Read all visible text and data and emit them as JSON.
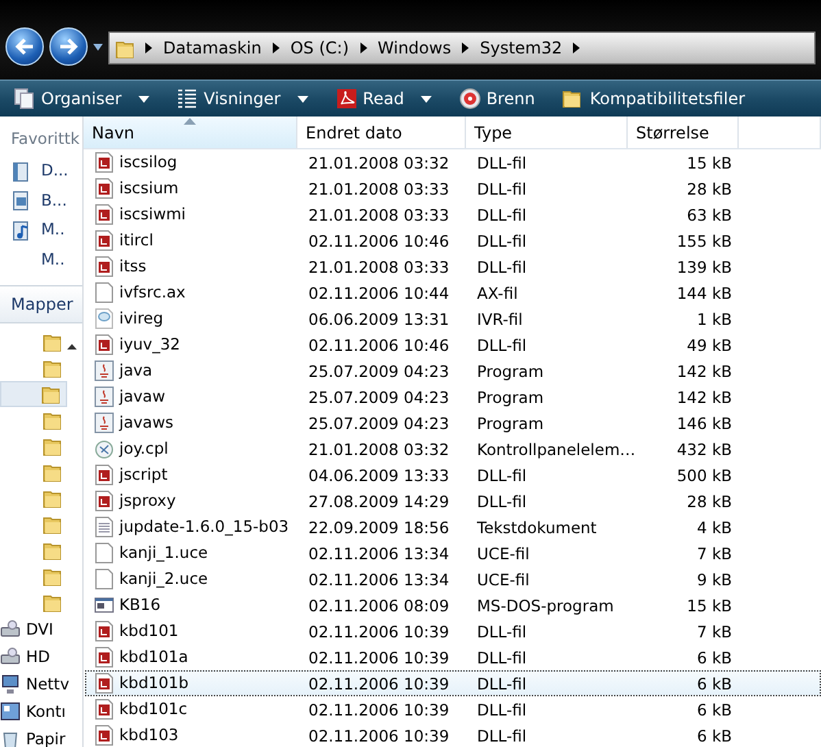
{
  "address_bar": {
    "crumbs": [
      "Datamaskin",
      "OS (C:)",
      "Windows",
      "System32"
    ]
  },
  "toolbar": [
    {
      "label": "Organiser",
      "kind": "organise",
      "dropdown": true
    },
    {
      "label": "Visninger",
      "kind": "views",
      "dropdown": true
    },
    {
      "label": "Read",
      "kind": "pdf",
      "dropdown": true
    },
    {
      "label": "Brenn",
      "kind": "burn",
      "dropdown": false
    },
    {
      "label": "Kompatibilitetsfiler",
      "kind": "folder",
      "dropdown": false
    }
  ],
  "navigation_pane": {
    "favorites_heading": "Favorittk",
    "favorites": [
      {
        "label": "D...",
        "kind": "docs"
      },
      {
        "label": "B...",
        "kind": "pics"
      },
      {
        "label": "M..",
        "kind": "music"
      },
      {
        "label": "M..",
        "kind": "none"
      }
    ],
    "folders_heading": "Mapper",
    "folders": [
      {
        "selected": false
      },
      {
        "selected": false
      },
      {
        "selected": true
      },
      {
        "selected": false
      },
      {
        "selected": false
      },
      {
        "selected": false
      },
      {
        "selected": false
      },
      {
        "selected": false
      },
      {
        "selected": false
      },
      {
        "selected": false
      },
      {
        "selected": false
      }
    ],
    "locations": [
      {
        "label": "DVI",
        "kind": "drive"
      },
      {
        "label": "HD",
        "kind": "drive"
      },
      {
        "label": "Nettv",
        "kind": "network"
      },
      {
        "label": "Kontı",
        "kind": "control"
      },
      {
        "label": "Papir",
        "kind": "bin"
      }
    ]
  },
  "table": {
    "columns": [
      {
        "label": "Navn",
        "sorted": true
      },
      {
        "label": "Endret dato",
        "sorted": false
      },
      {
        "label": "Type",
        "sorted": false
      },
      {
        "label": "Størrelse",
        "sorted": false
      }
    ],
    "rows": [
      {
        "kind": "dll",
        "name": "iscsilog",
        "date": "21.01.2008 03:32",
        "type": "DLL-fil",
        "size": "15 kB",
        "selected": false
      },
      {
        "kind": "dll",
        "name": "iscsium",
        "date": "21.01.2008 03:33",
        "type": "DLL-fil",
        "size": "28 kB",
        "selected": false
      },
      {
        "kind": "dll",
        "name": "iscsiwmi",
        "date": "21.01.2008 03:33",
        "type": "DLL-fil",
        "size": "63 kB",
        "selected": false
      },
      {
        "kind": "dll",
        "name": "itircl",
        "date": "02.11.2006 10:46",
        "type": "DLL-fil",
        "size": "155 kB",
        "selected": false
      },
      {
        "kind": "dll",
        "name": "itss",
        "date": "21.01.2008 03:33",
        "type": "DLL-fil",
        "size": "139 kB",
        "selected": false
      },
      {
        "kind": "blank",
        "name": "ivfsrc.ax",
        "date": "02.11.2006 10:44",
        "type": "AX-fil",
        "size": "144 kB",
        "selected": false
      },
      {
        "kind": "ivr",
        "name": "ivireg",
        "date": "06.06.2009 13:31",
        "type": "IVR-fil",
        "size": "1 kB",
        "selected": false
      },
      {
        "kind": "dll",
        "name": "iyuv_32",
        "date": "02.11.2006 10:46",
        "type": "DLL-fil",
        "size": "49 kB",
        "selected": false
      },
      {
        "kind": "java",
        "name": "java",
        "date": "25.07.2009 04:23",
        "type": "Program",
        "size": "142 kB",
        "selected": false
      },
      {
        "kind": "java",
        "name": "javaw",
        "date": "25.07.2009 04:23",
        "type": "Program",
        "size": "142 kB",
        "selected": false
      },
      {
        "kind": "java",
        "name": "javaws",
        "date": "25.07.2009 04:23",
        "type": "Program",
        "size": "146 kB",
        "selected": false
      },
      {
        "kind": "cpl",
        "name": "joy.cpl",
        "date": "21.01.2008 03:32",
        "type": "Kontrollpanelelem…",
        "size": "432 kB",
        "selected": false
      },
      {
        "kind": "dll",
        "name": "jscript",
        "date": "04.06.2009 13:33",
        "type": "DLL-fil",
        "size": "500 kB",
        "selected": false
      },
      {
        "kind": "dll",
        "name": "jsproxy",
        "date": "27.08.2009 14:29",
        "type": "DLL-fil",
        "size": "28 kB",
        "selected": false
      },
      {
        "kind": "text",
        "name": "jupdate-1.6.0_15-b03",
        "date": "22.09.2009 18:56",
        "type": "Tekstdokument",
        "size": "4 kB",
        "selected": false
      },
      {
        "kind": "blank",
        "name": "kanji_1.uce",
        "date": "02.11.2006 13:34",
        "type": "UCE-fil",
        "size": "7 kB",
        "selected": false
      },
      {
        "kind": "blank",
        "name": "kanji_2.uce",
        "date": "02.11.2006 13:34",
        "type": "UCE-fil",
        "size": "9 kB",
        "selected": false
      },
      {
        "kind": "dos",
        "name": "KB16",
        "date": "02.11.2006 08:09",
        "type": "MS-DOS-program",
        "size": "15 kB",
        "selected": false
      },
      {
        "kind": "dll",
        "name": "kbd101",
        "date": "02.11.2006 10:39",
        "type": "DLL-fil",
        "size": "7 kB",
        "selected": false
      },
      {
        "kind": "dll",
        "name": "kbd101a",
        "date": "02.11.2006 10:39",
        "type": "DLL-fil",
        "size": "6 kB",
        "selected": false
      },
      {
        "kind": "dll",
        "name": "kbd101b",
        "date": "02.11.2006 10:39",
        "type": "DLL-fil",
        "size": "6 kB",
        "selected": true
      },
      {
        "kind": "dll",
        "name": "kbd101c",
        "date": "02.11.2006 10:39",
        "type": "DLL-fil",
        "size": "6 kB",
        "selected": false
      },
      {
        "kind": "dll",
        "name": "kbd103",
        "date": "02.11.2006 10:39",
        "type": "DLL-fil",
        "size": "6 kB",
        "selected": false
      }
    ]
  }
}
